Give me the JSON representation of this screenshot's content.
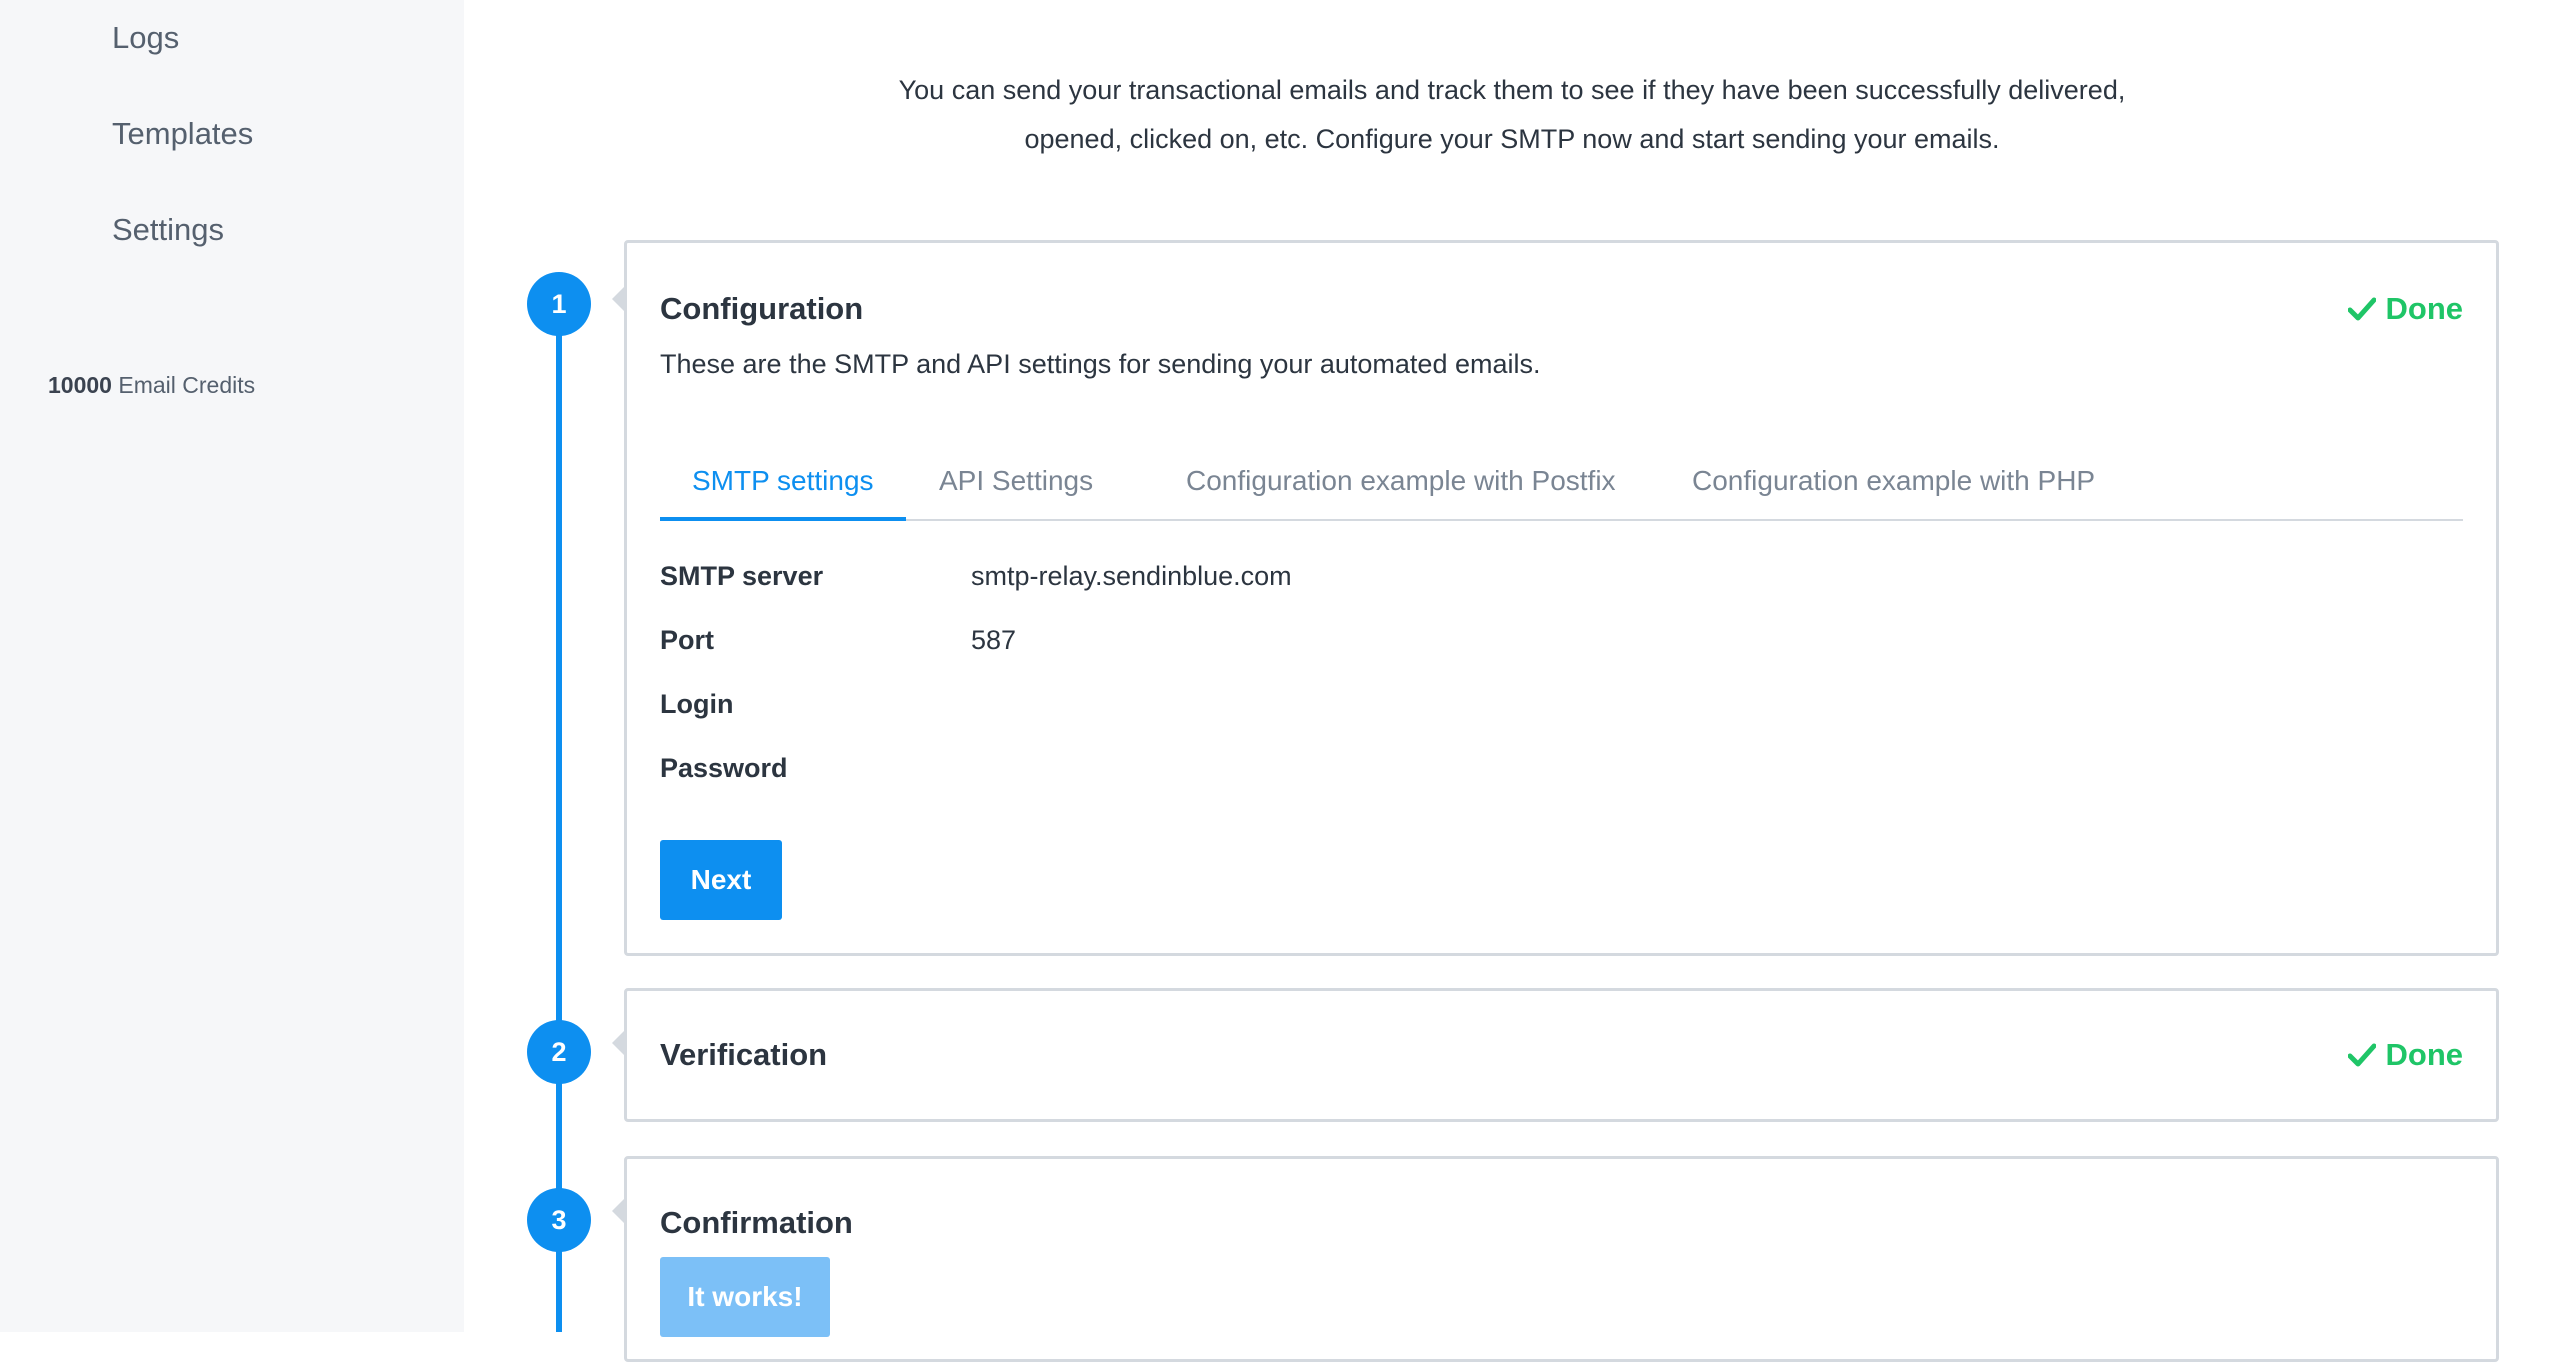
{
  "sidebar": {
    "items": [
      {
        "label": "Logs"
      },
      {
        "label": "Templates"
      },
      {
        "label": "Settings"
      }
    ],
    "credits_count": "10000",
    "credits_label": "Email Credits"
  },
  "intro": {
    "line1": "You can send your transactional emails and track them to see if they have been successfully delivered,",
    "line2": "opened, clicked on, etc. Configure your SMTP now and start sending your emails."
  },
  "steps": [
    {
      "number": "1",
      "title": "Configuration",
      "status": "Done",
      "description": "These are the SMTP and API settings for sending your automated emails.",
      "tabs": [
        {
          "label": "SMTP settings",
          "active": true
        },
        {
          "label": "API Settings",
          "active": false
        },
        {
          "label": "Configuration example with Postfix",
          "active": false
        },
        {
          "label": "Configuration example with PHP",
          "active": false
        }
      ],
      "fields": [
        {
          "label": "SMTP server",
          "value": "smtp-relay.sendinblue.com"
        },
        {
          "label": "Port",
          "value": "587"
        },
        {
          "label": "Login",
          "value": ""
        },
        {
          "label": "Password",
          "value": ""
        }
      ],
      "button": "Next"
    },
    {
      "number": "2",
      "title": "Verification",
      "status": "Done"
    },
    {
      "number": "3",
      "title": "Confirmation",
      "button": "It works!"
    }
  ],
  "colors": {
    "accent": "#0d8ff0",
    "success": "#1fc567",
    "border": "#d4d9df",
    "sidebar_bg": "#f6f7f9"
  },
  "icons": {
    "done": "check-icon"
  }
}
